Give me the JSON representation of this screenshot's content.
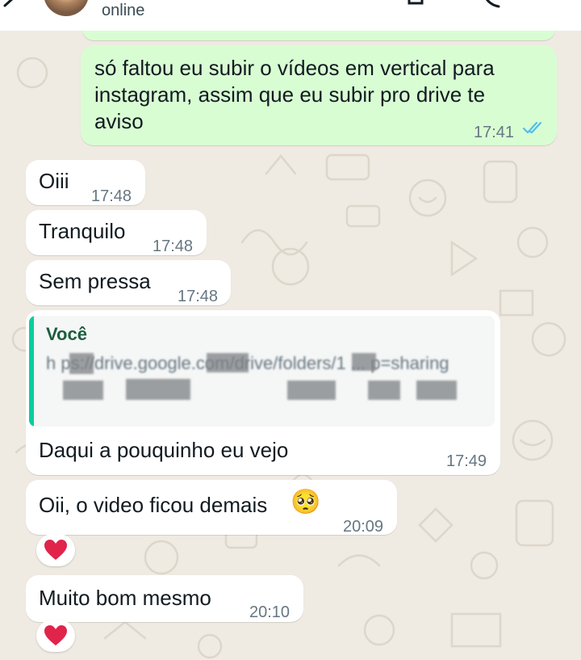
{
  "header": {
    "status": "online",
    "icons": [
      "back-icon",
      "video-call-icon",
      "voice-call-icon",
      "more-icon"
    ]
  },
  "messages": [
    {
      "direction": "outgoing",
      "text": "só faltou eu subir o vídeos em vertical para instagram, assim que eu subir pro drive te aviso",
      "lines": [
        "só faltou eu subir o vídeos em vertical para",
        "instagram, assim que eu subir pro drive te",
        "aviso"
      ],
      "time": "17:41",
      "status": "read"
    },
    {
      "direction": "incoming",
      "text": "Oiii",
      "time": "17:48"
    },
    {
      "direction": "incoming",
      "text": "Tranquilo",
      "time": "17:48"
    },
    {
      "direction": "incoming",
      "text": "Sem pressa",
      "time": "17:48"
    },
    {
      "direction": "incoming",
      "quote": {
        "author": "Você",
        "text": "h  ps://drive.google.com/drive/folders/1  ...  p=sharing"
      },
      "text": "Daqui a pouquinho eu vejo",
      "time": "17:49"
    },
    {
      "direction": "incoming",
      "text": "Oii, o video ficou demais",
      "emoji": "🥺",
      "time": "20:09",
      "reaction": "❤️"
    },
    {
      "direction": "incoming",
      "text": "Muito bom mesmo",
      "time": "20:10",
      "reaction": "❤️"
    }
  ],
  "colors": {
    "chat_background": "#efeae2",
    "incoming_bubble": "#ffffff",
    "outgoing_bubble": "#d9fdd3",
    "read_ticks": "#53bdeb",
    "quote_bar": "#06cf9c",
    "quote_author": "#1b5e3f",
    "heart": "#e0244a"
  }
}
